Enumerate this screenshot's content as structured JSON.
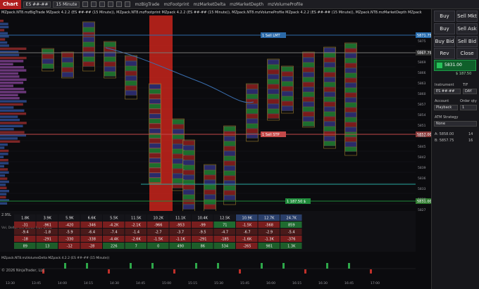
{
  "toolbar": {
    "title": "Chart",
    "instrument": "ES ##-##",
    "interval": "15 Minute",
    "buttons": [
      "mzBigTrade",
      "mzFootprint",
      "mzMarketDelta",
      "mzMarketDepth",
      "mzVolumeProfile"
    ]
  },
  "infobar": "MZpack.NT8.mzBigTrade MZpack 4.2.2 (ES ##-## (15 Minute)), MZpack.NT8.mzFootprint MZpack 4.2.2 (ES ##-## (15 Minute)), MZpack.NT8.mzVolumeProfile MZpack 4.2.2 (ES ##-## (15 Minute)), MZpack.NT8.mzMarketDepth MZpack 4.2.2 (ES ##-## (15 Minute))",
  "price_axis": {
    "labels": [
      "5875",
      "5872",
      "5869",
      "5866",
      "5863",
      "5860",
      "5857",
      "5854",
      "5851",
      "5848",
      "5845",
      "5842",
      "5839",
      "5836",
      "5833",
      "5830",
      "5827"
    ],
    "tags": [
      {
        "text": "5871.75",
        "color": "#2a6fb0"
      },
      {
        "text": "5867.75",
        "color": "#2f2f2f"
      },
      {
        "text": "5857.00",
        "color": "#8a3a3a"
      },
      {
        "text": "5831.00",
        "color": "#2f7a2f"
      }
    ]
  },
  "orders": [
    {
      "label": "1 Sell LMT",
      "color": "#2c6aa8"
    },
    {
      "label": "1 Sell STP",
      "color": "#c44a4a"
    },
    {
      "label": "1 187.50 $",
      "color": "#1f8a3a"
    }
  ],
  "time_axis": [
    "13:30",
    "13:45",
    "14:00",
    "14:15",
    "14:30",
    "14:45",
    "15:00",
    "15:15",
    "15:30",
    "15:45",
    "16:00",
    "16:15",
    "16:30",
    "16:45",
    "17:00"
  ],
  "delta_table": {
    "label": "2.95L",
    "header": "Vol, Delta, Min Delta, Max Delta",
    "rows": [
      [
        "1.8K",
        "3.9K",
        "5.9K",
        "6.6K",
        "5.5K",
        "11.5K",
        "10.2K",
        "11.1K",
        "10.4K",
        "12.5K",
        "10.9K",
        "12.7K",
        "24.7K"
      ],
      [
        "-31",
        "-961",
        "-420",
        "-346",
        "-4.2K",
        "-2.1K",
        "-966",
        "-953",
        "-99",
        "71",
        "-1.5K",
        "-568",
        "859"
      ],
      [
        "-9.4",
        "-1.8",
        "-5.9",
        "-6.4",
        "-7.4",
        "-1.4",
        "-2.7",
        "-3.7",
        "-9.5",
        "-4.7",
        "-6.7",
        "-2.9",
        "-5.4"
      ],
      [
        "-18",
        "-291",
        "-330",
        "-338",
        "-4.4K",
        "-2.6K",
        "-1.5K",
        "-1.1K",
        "-291",
        "-185",
        "-1.6K",
        "-1.3K",
        "-376"
      ],
      [
        "89",
        "13",
        "-12",
        "-28",
        "226",
        "7",
        "0",
        "490",
        "86",
        "534",
        "-265",
        "981",
        "1.3K"
      ]
    ]
  },
  "volume_indicator": {
    "label": "MZpack.NT8.mzVolumeDelta MZpack 4.2.2 (ES ##-## (15 Minute))"
  },
  "footer": "© 2026 NinjaTrader, LLC",
  "side_panel": {
    "buttons": [
      "Buy Mkt",
      "Sell Mkt",
      "Buy Ask",
      "Sell Ask",
      "Buy Bid",
      "Sell Bid",
      "Rev",
      "Close"
    ],
    "price": "5831.00",
    "pnl": "$ 187.50",
    "instrument_label": "Instrument",
    "tif_label": "TIF",
    "instrument": "ES ##-##",
    "tif": "DAY",
    "account_label": "Account",
    "qty_label": "Order qty",
    "account": "Playback",
    "qty": "1",
    "atm_label": "ATM Strategy",
    "atm": "None",
    "avg_a_label": "A: 5858.00",
    "avg_a_val": "14",
    "avg_b_label": "B: 5857.75",
    "avg_b_val": "16"
  },
  "colors": {
    "background": "#0b0b0e",
    "buy": "#2ea84a",
    "sell": "#c0302a",
    "highlight": "#d9261c"
  }
}
